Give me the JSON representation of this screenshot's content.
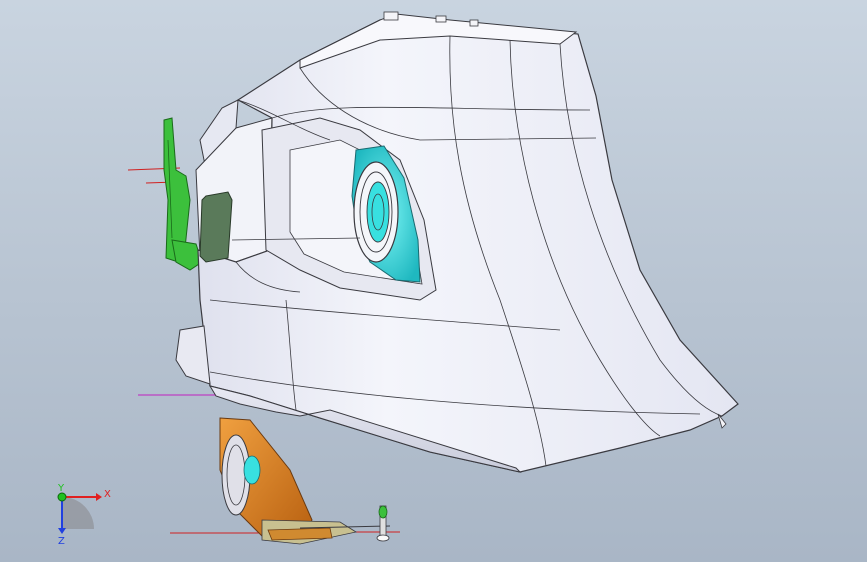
{
  "viewport": {
    "background_top": "#c9d4e0",
    "background_bottom": "#a9b6c6"
  },
  "model": {
    "body_color": "#eef0f7",
    "body_shade": "#cfd2e0",
    "edge_color": "#3a3a40",
    "lamp_color": "#38e0e0",
    "bracket_color": "#3cc03c",
    "reflector_color": "#e08a20",
    "ref_line_red": "#d02020",
    "ref_line_magenta": "#c020c0",
    "window_color": "#5a7a5a"
  },
  "triad": {
    "x_label": "X",
    "y_label": "Y",
    "z_label": "Z",
    "x_color": "#e02020",
    "y_color": "#20c020",
    "z_color": "#2040e0"
  }
}
